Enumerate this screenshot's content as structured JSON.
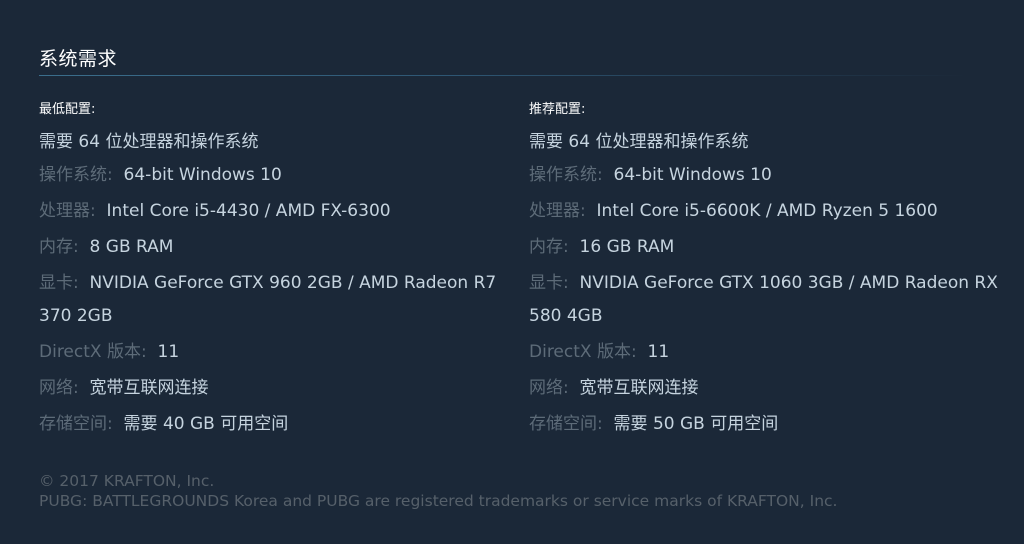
{
  "section": {
    "title": "系统需求"
  },
  "minimum": {
    "heading": "最低配置:",
    "note": "需要 64 位处理器和操作系统",
    "rows": [
      {
        "label": "操作系统:",
        "value": "64-bit Windows 10"
      },
      {
        "label": "处理器:",
        "value": "Intel Core i5-4430 / AMD FX-6300"
      },
      {
        "label": "内存:",
        "value": "8 GB RAM"
      },
      {
        "label": "显卡:",
        "value": "NVIDIA GeForce GTX 960 2GB / AMD Radeon R7 370 2GB"
      },
      {
        "label": "DirectX 版本:",
        "value": "11"
      },
      {
        "label": "网络:",
        "value": "宽带互联网连接"
      },
      {
        "label": "存储空间:",
        "value": "需要 40 GB 可用空间"
      }
    ]
  },
  "recommended": {
    "heading": "推荐配置:",
    "note": "需要 64 位处理器和操作系统",
    "rows": [
      {
        "label": "操作系统:",
        "value": "64-bit Windows 10"
      },
      {
        "label": "处理器:",
        "value": "Intel Core i5-6600K / AMD Ryzen 5 1600"
      },
      {
        "label": "内存:",
        "value": "16 GB RAM"
      },
      {
        "label": "显卡:",
        "value": "NVIDIA GeForce GTX 1060 3GB / AMD Radeon RX 580 4GB"
      },
      {
        "label": "DirectX 版本:",
        "value": "11"
      },
      {
        "label": "网络:",
        "value": "宽带互联网连接"
      },
      {
        "label": "存储空间:",
        "value": "需要 50 GB 可用空间"
      }
    ]
  },
  "footer": {
    "copyright": "© 2017 KRAFTON, Inc.",
    "trademark": "PUBG: BATTLEGROUNDS Korea and PUBG are registered trademarks or service marks of KRAFTON, Inc."
  },
  "colors": {
    "background": "#1b2838",
    "label": "#5d6b78",
    "value": "#c6d4df",
    "heading": "#ffffff",
    "footer": "#56606a",
    "rule": "#3b6e8c"
  }
}
